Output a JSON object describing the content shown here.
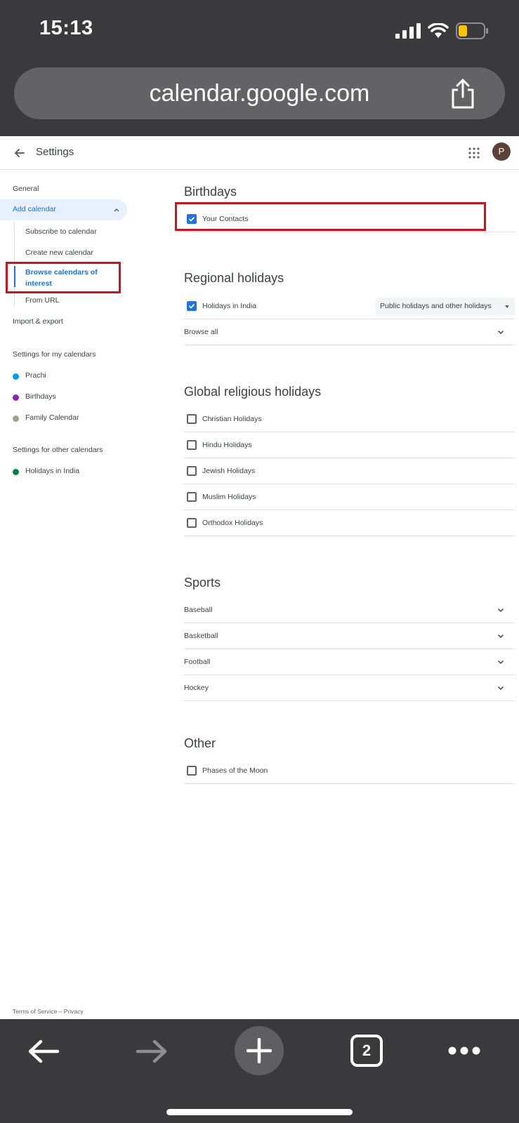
{
  "status_bar": {
    "time": "15:13"
  },
  "browser": {
    "url": "calendar.google.com",
    "open_tabs": "2"
  },
  "header": {
    "title": "Settings",
    "avatar_letter": "P"
  },
  "sidebar": {
    "general": "General",
    "add_calendar": "Add calendar",
    "sub_items": {
      "subscribe": "Subscribe to calendar",
      "create_new": "Create new calendar",
      "browse": "Browse calendars of interest",
      "from_url": "From URL"
    },
    "import_export": "Import & export",
    "my_calendars_heading": "Settings for my calendars",
    "my_calendars": [
      {
        "label": "Prachi",
        "color": "#039be5"
      },
      {
        "label": "Birthdays",
        "color": "#8e24aa"
      },
      {
        "label": "Family Calendar",
        "color": "#a79b8e"
      }
    ],
    "other_calendars_heading": "Settings for other calendars",
    "other_calendars": [
      {
        "label": "Holidays in India",
        "color": "#0b8043"
      }
    ],
    "footer": "Terms of Service – Privacy"
  },
  "main": {
    "birthdays": {
      "title": "Birthdays",
      "items": [
        {
          "label": "Your Contacts",
          "checked": true
        }
      ]
    },
    "regional": {
      "title": "Regional holidays",
      "holidays_in_india": "Holidays in India",
      "holidays_checked": true,
      "holiday_type_selected": "Public holidays and other holidays",
      "browse_all": "Browse all"
    },
    "religious": {
      "title": "Global religious holidays",
      "items": [
        {
          "label": "Christian Holidays",
          "checked": false
        },
        {
          "label": "Hindu Holidays",
          "checked": false
        },
        {
          "label": "Jewish Holidays",
          "checked": false
        },
        {
          "label": "Muslim Holidays",
          "checked": false
        },
        {
          "label": "Orthodox Holidays",
          "checked": false
        }
      ]
    },
    "sports": {
      "title": "Sports",
      "items": [
        "Baseball",
        "Basketball",
        "Football",
        "Hockey"
      ]
    },
    "other": {
      "title": "Other",
      "items": [
        {
          "label": "Phases of the Moon",
          "checked": false
        }
      ]
    }
  },
  "colors": {
    "accent": "#1a73e8",
    "highlight_box": "#d0121b"
  }
}
